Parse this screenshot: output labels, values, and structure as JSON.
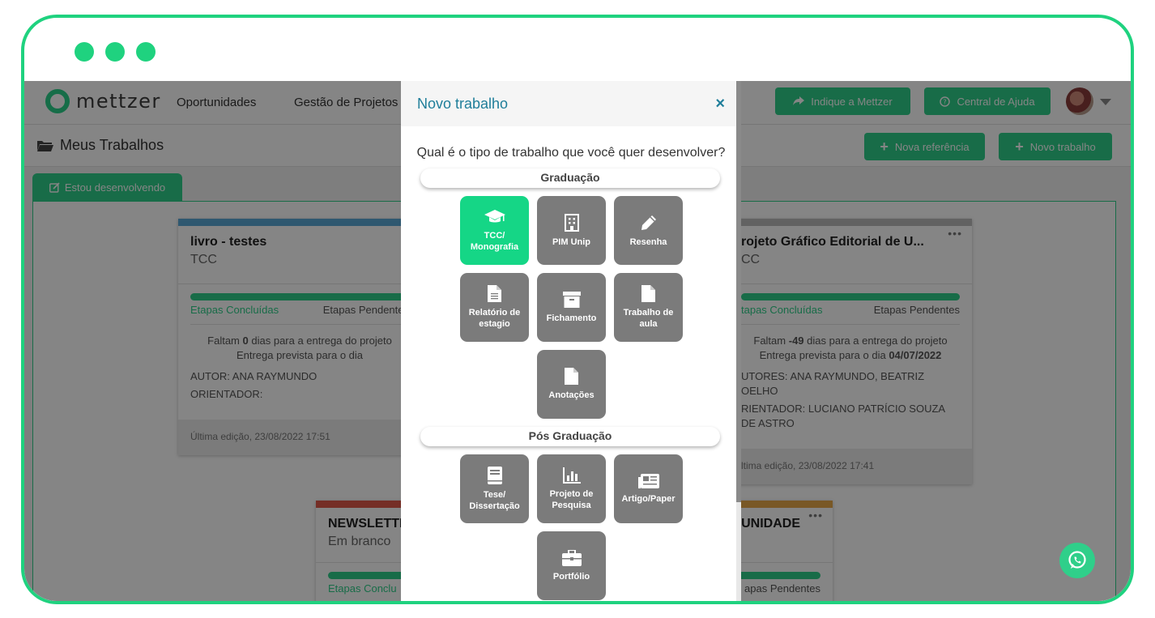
{
  "header": {
    "logo_text": "mettzer",
    "nav": [
      "Oportunidades",
      "Gestão de Projetos"
    ],
    "indique_label": "Indique a Mettzer",
    "ajuda_label": "Central de Ajuda"
  },
  "subheader": {
    "title": "Meus Trabalhos",
    "nova_referencia_label": "Nova referência",
    "novo_trabalho_label": "Novo trabalho"
  },
  "tab": {
    "label": "Estou desenvolvendo"
  },
  "cards": [
    {
      "title": "livro - testes",
      "type": "TCC",
      "stripe_color": "#5aa9d6",
      "done_label": "Etapas Concluídas",
      "pending_label": "Etapas Pendentes",
      "days_prefix": "Faltam",
      "days": "0",
      "days_suffix": "dias para a entrega do projeto",
      "delivery_label": "Entrega prevista para o dia",
      "delivery_date": "",
      "author": "AUTOR: ANA RAYMUNDO",
      "advisor": "ORIENTADOR:",
      "last_edit": "Última edição, 23/08/2022 17:51"
    },
    {
      "title": "rojeto Gráfico Editorial de U...",
      "type": "CC",
      "stripe_color": "#bdbdbd",
      "done_label": "tapas Concluídas",
      "pending_label": "Etapas Pendentes",
      "days_prefix": "Faltam",
      "days": "-49",
      "days_suffix": "dias para a entrega do projeto",
      "delivery_label": "Entrega prevista para o dia",
      "delivery_date": "04/07/2022",
      "author": "UTORES: ANA RAYMUNDO, BEATRIZ OELHO",
      "advisor": "RIENTADOR: LUCIANO PATRÍCIO SOUZA DE ASTRO",
      "last_edit": "ltima edição, 23/08/2022 17:41"
    },
    {
      "title": "NEWSLETTE",
      "type": "Em branco",
      "stripe_color": "#e0594a",
      "done_label": "Etapas Conclu",
      "pending_label": ""
    },
    {
      "title": "UNIDADE",
      "type": "",
      "stripe_color": "#e9a94a",
      "done_label": "",
      "pending_label": "apas Pendentes"
    }
  ],
  "modal": {
    "title": "Novo trabalho",
    "close": "×",
    "question": "Qual é o tipo de trabalho que você quer desenvolver?",
    "graduacao_label": "Graduação",
    "pos_label": "Pós Graduação",
    "graduacao_items": [
      {
        "label": "TCC/ Monografia",
        "icon": "graduation-cap-icon",
        "active": true
      },
      {
        "label": "PIM Unip",
        "icon": "building-icon",
        "active": false
      },
      {
        "label": "Resenha",
        "icon": "pencil-icon",
        "active": false
      },
      {
        "label": "Relatório de estagio",
        "icon": "document-icon",
        "active": false
      },
      {
        "label": "Fichamento",
        "icon": "archive-box-icon",
        "active": false
      },
      {
        "label": "Trabalho de aula",
        "icon": "file-icon",
        "active": false
      },
      {
        "label": "Anotações",
        "icon": "file-icon",
        "active": false
      }
    ],
    "pos_items": [
      {
        "label": "Tese/ Dissertação",
        "icon": "book-icon",
        "active": false
      },
      {
        "label": "Projeto de Pesquisa",
        "icon": "bar-chart-icon",
        "active": false
      },
      {
        "label": "Artigo/Paper",
        "icon": "newspaper-icon",
        "active": false
      },
      {
        "label": "Portfólio",
        "icon": "briefcase-icon",
        "active": false
      }
    ]
  },
  "colors": {
    "accent": "#2fcf8a",
    "frame": "#1fd27f",
    "modal_title": "#1f7e9a",
    "tile": "#7b7b7b",
    "tile_active": "#15d686"
  }
}
